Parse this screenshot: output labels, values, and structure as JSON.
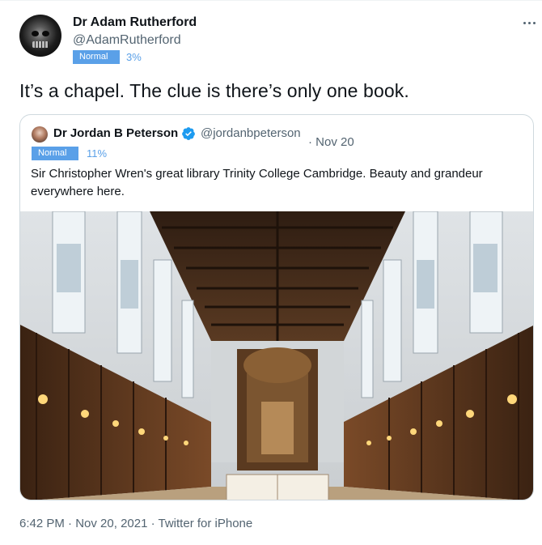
{
  "tweet": {
    "author_name": "Dr Adam Rutherford",
    "author_handle": "@AdamRutherford",
    "badge_label": "Normal",
    "badge_percent": "3%",
    "text": "It’s a chapel. The clue is there’s only one book.",
    "more_icon": "more-horizontal-icon",
    "avatar_icon": "skull-avatar"
  },
  "quoted": {
    "author_name": "Dr Jordan B Peterson",
    "author_handle": "@jordanbpeterson",
    "date": "· Nov 20",
    "badge_label": "Normal",
    "badge_percent": "11%",
    "text": "Sir Christopher Wren's great library Trinity College Cambridge. Beauty and grandeur everywhere here.",
    "verified_icon": "verified-badge-icon",
    "verified_color": "#1d9bf0"
  },
  "footer": {
    "time": "6:42 PM",
    "sep1": " · ",
    "date": "Nov 20, 2021",
    "sep2": " · ",
    "source": "Twitter for iPhone"
  },
  "colors": {
    "badge_bg": "#5aa0e8",
    "muted_text": "#536471",
    "border": "#cfd9de"
  }
}
